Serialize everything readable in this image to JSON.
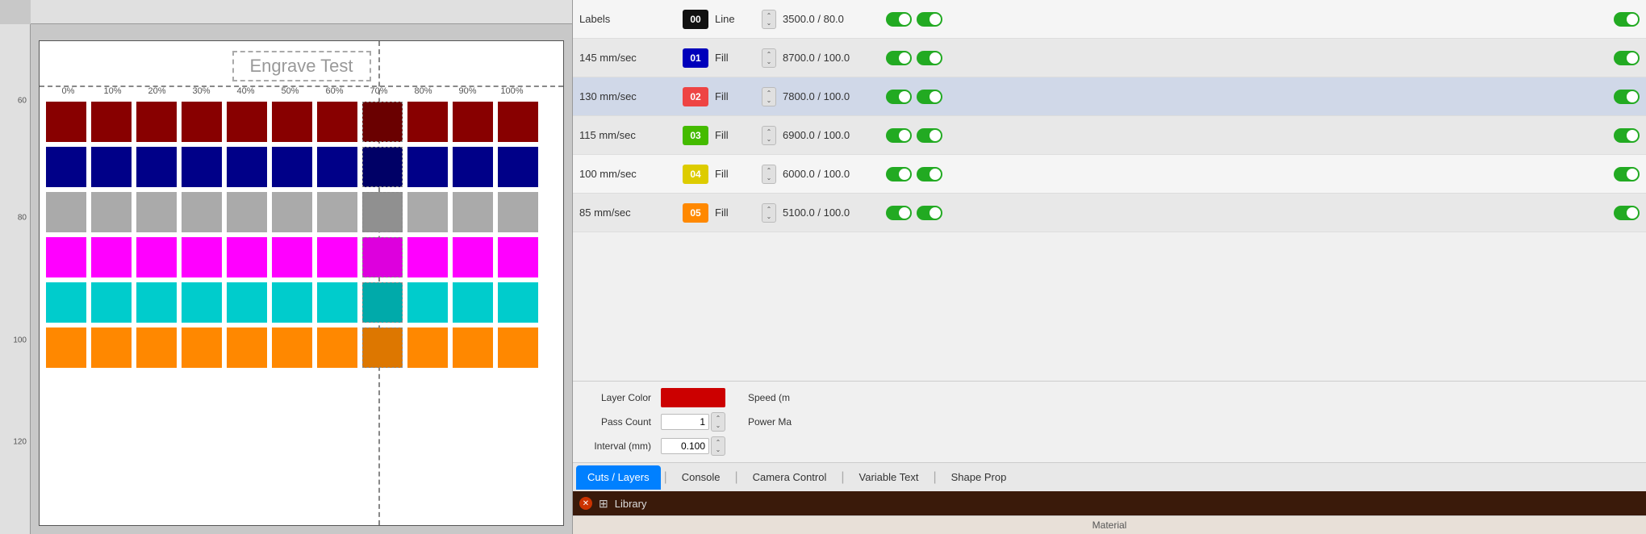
{
  "canvas": {
    "title": "Engrave Test",
    "ruler_y_marks": [
      60,
      80,
      100,
      120
    ],
    "percent_labels": [
      "0%",
      "10%",
      "20%",
      "30%",
      "40%",
      "50%",
      "60%",
      "70%",
      "80%",
      "90%",
      "100%"
    ],
    "color_rows": [
      {
        "color": "#990000",
        "count": 11
      },
      {
        "color": "#000099",
        "count": 11
      },
      {
        "color": "#aaaaaa",
        "count": 11
      },
      {
        "color": "#ff00ff",
        "count": 11
      },
      {
        "color": "#00cccc",
        "count": 11
      },
      {
        "color": "#ff8800",
        "count": 11
      }
    ]
  },
  "layers": {
    "rows": [
      {
        "speed": "Labels",
        "badge_color": "#111111",
        "badge_text": "00",
        "mode": "Line",
        "power": "3500.0 / 80.0",
        "toggle1": true,
        "toggle2": true,
        "toggle3": true,
        "highlighted": false
      },
      {
        "speed": "145 mm/sec",
        "badge_color": "#0000bb",
        "badge_text": "01",
        "mode": "Fill",
        "power": "8700.0 / 100.0",
        "toggle1": true,
        "toggle2": true,
        "toggle3": true,
        "highlighted": false
      },
      {
        "speed": "130 mm/sec",
        "badge_color": "#ee4444",
        "badge_text": "02",
        "mode": "Fill",
        "power": "7800.0 / 100.0",
        "toggle1": true,
        "toggle2": true,
        "toggle3": true,
        "highlighted": true
      },
      {
        "speed": "115 mm/sec",
        "badge_color": "#44bb00",
        "badge_text": "03",
        "mode": "Fill",
        "power": "6900.0 / 100.0",
        "toggle1": true,
        "toggle2": true,
        "toggle3": true,
        "highlighted": false
      },
      {
        "speed": "100 mm/sec",
        "badge_color": "#ddcc00",
        "badge_text": "04",
        "mode": "Fill",
        "power": "6000.0 / 100.0",
        "toggle1": true,
        "toggle2": true,
        "toggle3": true,
        "highlighted": false
      },
      {
        "speed": "85 mm/sec",
        "badge_color": "#ff8800",
        "badge_text": "05",
        "mode": "Fill",
        "power": "5100.0 / 100.0",
        "toggle1": true,
        "toggle2": true,
        "toggle3": true,
        "highlighted": false
      }
    ],
    "properties": {
      "layer_color_label": "Layer Color",
      "speed_label": "Speed (m",
      "pass_count_label": "Pass Count",
      "pass_count_value": "1",
      "power_max_label": "Power Ma",
      "interval_label": "Interval (mm)",
      "interval_value": "0.100"
    },
    "tabs": {
      "cuts_layers": "Cuts / Layers",
      "console": "Console",
      "camera_control": "Camera Control",
      "variable_text": "Variable Text",
      "shape_prop": "Shape Prop"
    },
    "library": {
      "label": "Library",
      "material_label": "Material"
    }
  }
}
